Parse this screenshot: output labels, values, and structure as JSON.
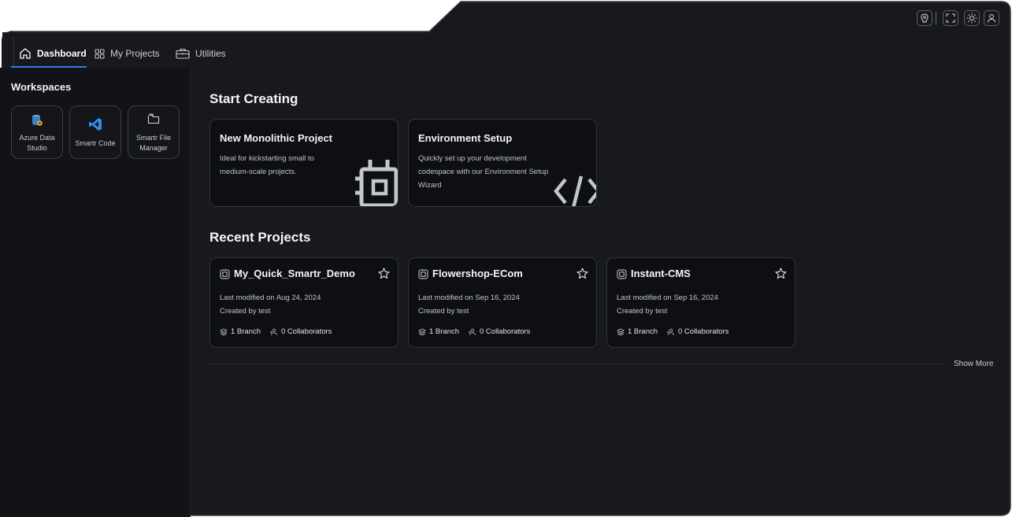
{
  "theme": {
    "accent": "#2f7cf0",
    "background": "#17191d",
    "card": "#0d0f12"
  },
  "toolbar": {
    "icons": [
      "assistant-icon",
      "fullscreen-icon",
      "brightness-icon",
      "user-icon"
    ]
  },
  "nav": {
    "tabs": [
      {
        "label": "Dashboard",
        "icon": "home-icon",
        "active": true
      },
      {
        "label": "My Projects",
        "icon": "grid-icon",
        "active": false
      },
      {
        "label": "Utilities",
        "icon": "briefcase-icon",
        "active": false
      }
    ]
  },
  "sidebar": {
    "title": "Workspaces",
    "tiles": [
      {
        "label": "Azure Data Studio",
        "icon": "azure-data-studio-icon"
      },
      {
        "label": "Smartr Code",
        "icon": "vscode-icon"
      },
      {
        "label": "Smartr File Manager",
        "icon": "folder-icon"
      }
    ]
  },
  "start": {
    "title": "Start Creating",
    "cards": [
      {
        "title": "New Monolithic Project",
        "description": "Ideal for kickstarting small to medium-scale projects.",
        "icon": "chip-icon"
      },
      {
        "title": "Environment Setup",
        "description": "Quickly set up your development codespace with our Environment Setup Wizard",
        "icon": "code-icon"
      }
    ]
  },
  "recent": {
    "title": "Recent Projects",
    "projects": [
      {
        "name": "My_Quick_Smartr_Demo",
        "modified": "Last modified on Aug 24, 2024",
        "created": "Created by test",
        "branches": "1 Branch",
        "collaborators": "0 Collaborators"
      },
      {
        "name": "Flowershop-ECom",
        "modified": "Last modified on Sep 16, 2024",
        "created": "Created by test",
        "branches": "1 Branch",
        "collaborators": "0 Collaborators"
      },
      {
        "name": "Instant-CMS",
        "modified": "Last modified on Sep 16, 2024",
        "created": "Created by test",
        "branches": "1 Branch",
        "collaborators": "0 Collaborators"
      }
    ],
    "show_more": "Show More"
  }
}
